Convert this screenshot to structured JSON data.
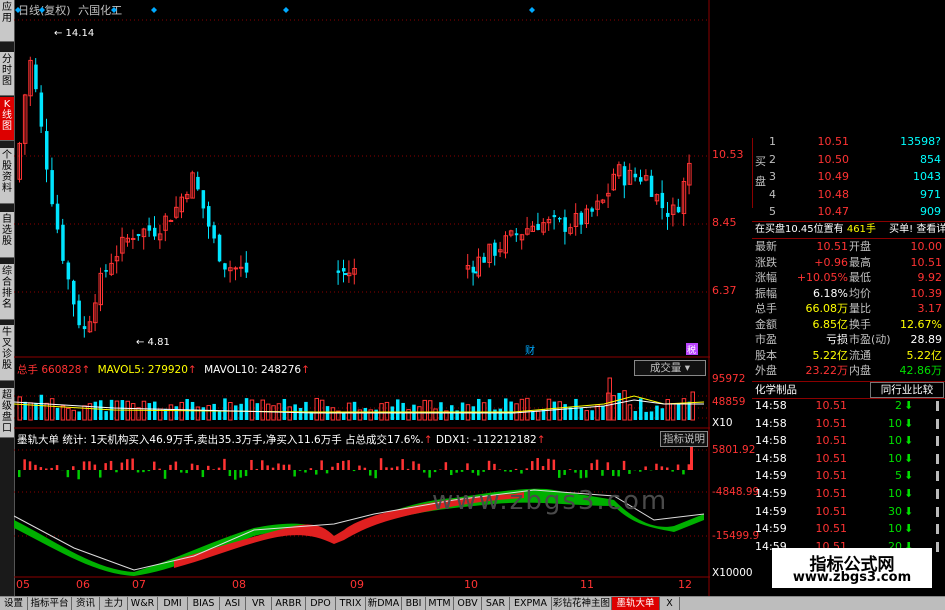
{
  "header": {
    "title": "日线(复权)",
    "stock": "六国化工"
  },
  "sidebar": [
    "应用",
    "分时图",
    "K线图",
    "个股资料",
    "自选股",
    "综合排名",
    "牛叉诊股",
    "超级盘口"
  ],
  "price_axis": [
    "10.53",
    "8.45",
    "6.37"
  ],
  "annotations": {
    "high": "14.14",
    "low": "4.81",
    "finance_marker": "财",
    "marker2": "税"
  },
  "volume": {
    "label": "总手",
    "total": "660828",
    "mavol5": "MAVOL5: 279920",
    "mavol10": "MAVOL10: 248276",
    "type_button": "成交量",
    "axis": [
      "95972",
      "48859",
      "X10"
    ]
  },
  "indicator": {
    "name": "墨轨大单",
    "stats": "统计: 1天机构买入46.9万手,卖出35.3万手,净买入11.6万手 占总成交17.6%.",
    "ddx": "DDX1: -112212182",
    "help_button": "指标说明",
    "axis": [
      "5801.92",
      "-4848.99",
      "-15499.9",
      "X10000"
    ]
  },
  "xaxis": [
    "05",
    "06",
    "07",
    "08",
    "09",
    "10",
    "11",
    "12"
  ],
  "order_book": {
    "side_label": "买盘",
    "rows": [
      {
        "n": "2",
        "price": "10.50",
        "vol": "854"
      },
      {
        "n": "3",
        "price": "10.49",
        "vol": "1043"
      },
      {
        "n": "4",
        "price": "10.48",
        "vol": "971"
      },
      {
        "n": "5",
        "price": "10.47",
        "vol": "909"
      }
    ],
    "top_partial": {
      "n": "1",
      "price": "10.51",
      "vol": "13598?"
    }
  },
  "bid_info": {
    "text": "在买盘10.45位置有",
    "qty": "461手",
    "buy_one": "买单!",
    "detail": "查看详细"
  },
  "quote": [
    {
      "l1": "最新",
      "v1": "10.51",
      "l2": "开盘",
      "v2": "10.00"
    },
    {
      "l1": "涨跌",
      "v1": "+0.96",
      "l2": "最高",
      "v2": "10.51"
    },
    {
      "l1": "涨幅",
      "v1": "+10.05%",
      "l2": "最低",
      "v2": "9.92"
    },
    {
      "l1": "振幅",
      "v1": "6.18%",
      "l2": "均价",
      "v2": "10.39"
    },
    {
      "l1": "总手",
      "v1": "66.08万",
      "l2": "量比",
      "v2": "3.17"
    },
    {
      "l1": "金额",
      "v1": "6.85亿",
      "l2": "换手",
      "v2": "12.67%"
    },
    {
      "l1": "市盈",
      "v1": "亏损",
      "l2": "市盈(动)",
      "v2": "28.89"
    },
    {
      "l1": "股本",
      "v1": "5.22亿",
      "l2": "流通",
      "v2": "5.22亿"
    },
    {
      "l1": "外盘",
      "v1": "23.22万",
      "l2": "内盘",
      "v2": "42.86万"
    }
  ],
  "industry": {
    "label": "化学制品",
    "compare": "同行业比较"
  },
  "trades": [
    {
      "t": "14:58",
      "p": "10.51",
      "v": "2"
    },
    {
      "t": "14:58",
      "p": "10.51",
      "v": "10"
    },
    {
      "t": "14:58",
      "p": "10.51",
      "v": "10"
    },
    {
      "t": "14:58",
      "p": "10.51",
      "v": "10"
    },
    {
      "t": "14:59",
      "p": "10.51",
      "v": "5"
    },
    {
      "t": "14:59",
      "p": "10.51",
      "v": "10"
    },
    {
      "t": "14:59",
      "p": "10.51",
      "v": "30"
    },
    {
      "t": "14:59",
      "p": "10.51",
      "v": "10"
    },
    {
      "t": "14:59",
      "p": "10.51",
      "v": "20"
    }
  ],
  "bottom_tabs": [
    "设置",
    "指标平台",
    "资讯",
    "主力",
    "W&R",
    "DMI",
    "BIAS",
    "ASI",
    "VR",
    "ARBR",
    "DPO",
    "TRIX",
    "新DMA",
    "BBI",
    "MTM",
    "OBV",
    "SAR",
    "EXPMA",
    "彩钻花神主图",
    "墨轨大单",
    "X"
  ],
  "watermark": "www.zbgs3.com",
  "logo": {
    "title": "指标公式网",
    "url": "www.zbgs3.com"
  },
  "colors": {
    "up": "#ff3333",
    "down": "#00e5ff",
    "bg": "#000000",
    "grid": "#8b0000"
  }
}
